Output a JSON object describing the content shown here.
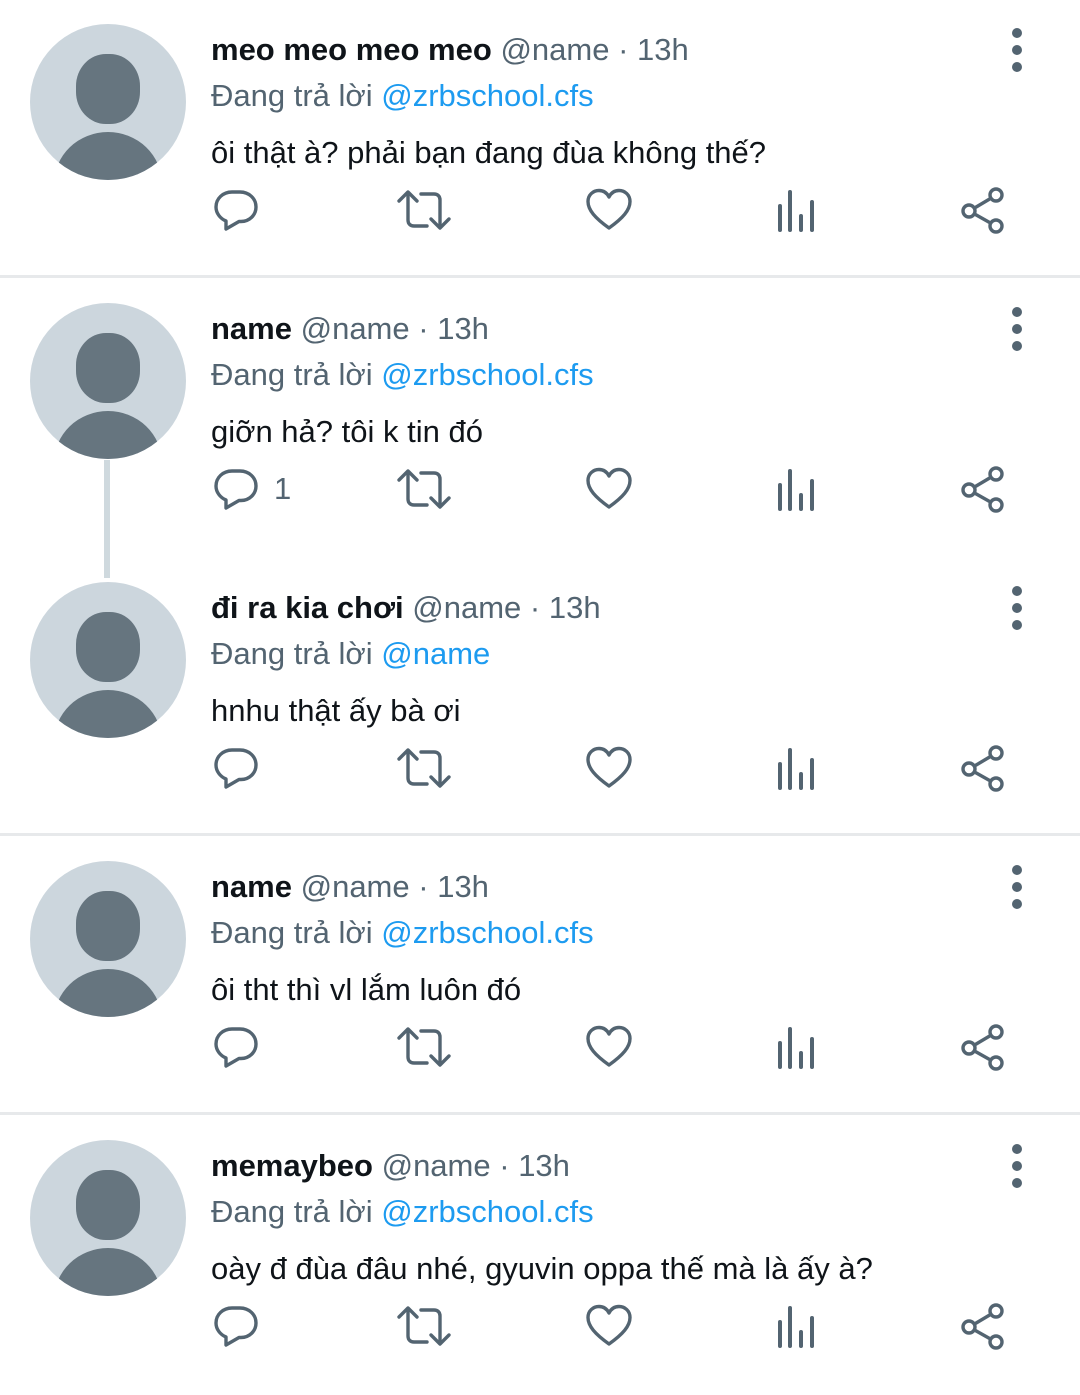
{
  "tweets": [
    {
      "name": "meo meo meo meo",
      "handle": "@name",
      "dot": "·",
      "time": "13h",
      "reply_prefix": "Đang trả lời",
      "reply_to": "@zrbschool.cfs",
      "text": "ôi thật à? phải bạn đang đùa không thế?",
      "reply_count": ""
    },
    {
      "name": "name",
      "handle": "@name",
      "dot": "·",
      "time": "13h",
      "reply_prefix": "Đang trả lời",
      "reply_to": "@zrbschool.cfs",
      "text": "giỡn hả? tôi k tin đó",
      "reply_count": "1"
    },
    {
      "name": "đi ra kia chơi",
      "handle": "@name",
      "dot": "·",
      "time": "13h",
      "reply_prefix": "Đang trả lời",
      "reply_to": "@name",
      "text": "hnhu thật ấy bà ơi",
      "reply_count": ""
    },
    {
      "name": "name",
      "handle": "@name",
      "dot": "·",
      "time": "13h",
      "reply_prefix": "Đang trả lời",
      "reply_to": "@zrbschool.cfs",
      "text": "ôi tht thì vl lắm luôn đó",
      "reply_count": ""
    },
    {
      "name": "memaybeo",
      "handle": "@name",
      "dot": "·",
      "time": "13h",
      "reply_prefix": "Đang trả lời",
      "reply_to": "@zrbschool.cfs",
      "text": "oày đ đùa đâu nhé, gyuvin oppa thế mà là ấy à?",
      "reply_count": ""
    }
  ],
  "icons": {
    "avatar": "default-avatar-icon",
    "more": "more-vertical-icon",
    "reply": "reply-icon",
    "retweet": "retweet-icon",
    "like": "heart-icon",
    "views": "views-icon",
    "share": "share-icon"
  },
  "colors": {
    "text_primary": "#0f1419",
    "text_secondary": "#536471",
    "link": "#1d9bf0",
    "avatar_bg": "#ccd6dd",
    "avatar_fg": "#66757f",
    "divider": "#e7e9eb",
    "thread_line": "#cfd9de"
  }
}
